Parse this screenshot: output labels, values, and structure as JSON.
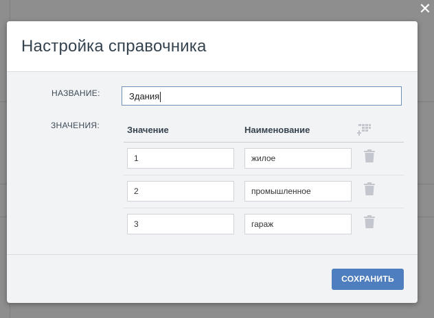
{
  "dialog": {
    "title": "Настройка справочника",
    "close_icon": "close-icon"
  },
  "form": {
    "name_label": "НАЗВАНИЕ:",
    "name_value": "Здания",
    "values_label": "ЗНАЧЕНИЯ:"
  },
  "table": {
    "columns": [
      "Значение",
      "Наименование"
    ],
    "add_column_icon": "table-add-icon",
    "rows": [
      {
        "value": "1",
        "name": "жилое"
      },
      {
        "value": "2",
        "name": "промышленное"
      },
      {
        "value": "3",
        "name": "гараж"
      }
    ],
    "row_action_icon": "trash-icon"
  },
  "footer": {
    "save_label": "СОХРАНИТЬ"
  },
  "colors": {
    "overlay": "#8e8e8e",
    "dialog_body": "#f2f3f5",
    "primary_button": "#4f7ebe",
    "active_input_border": "#6d8fb5"
  }
}
